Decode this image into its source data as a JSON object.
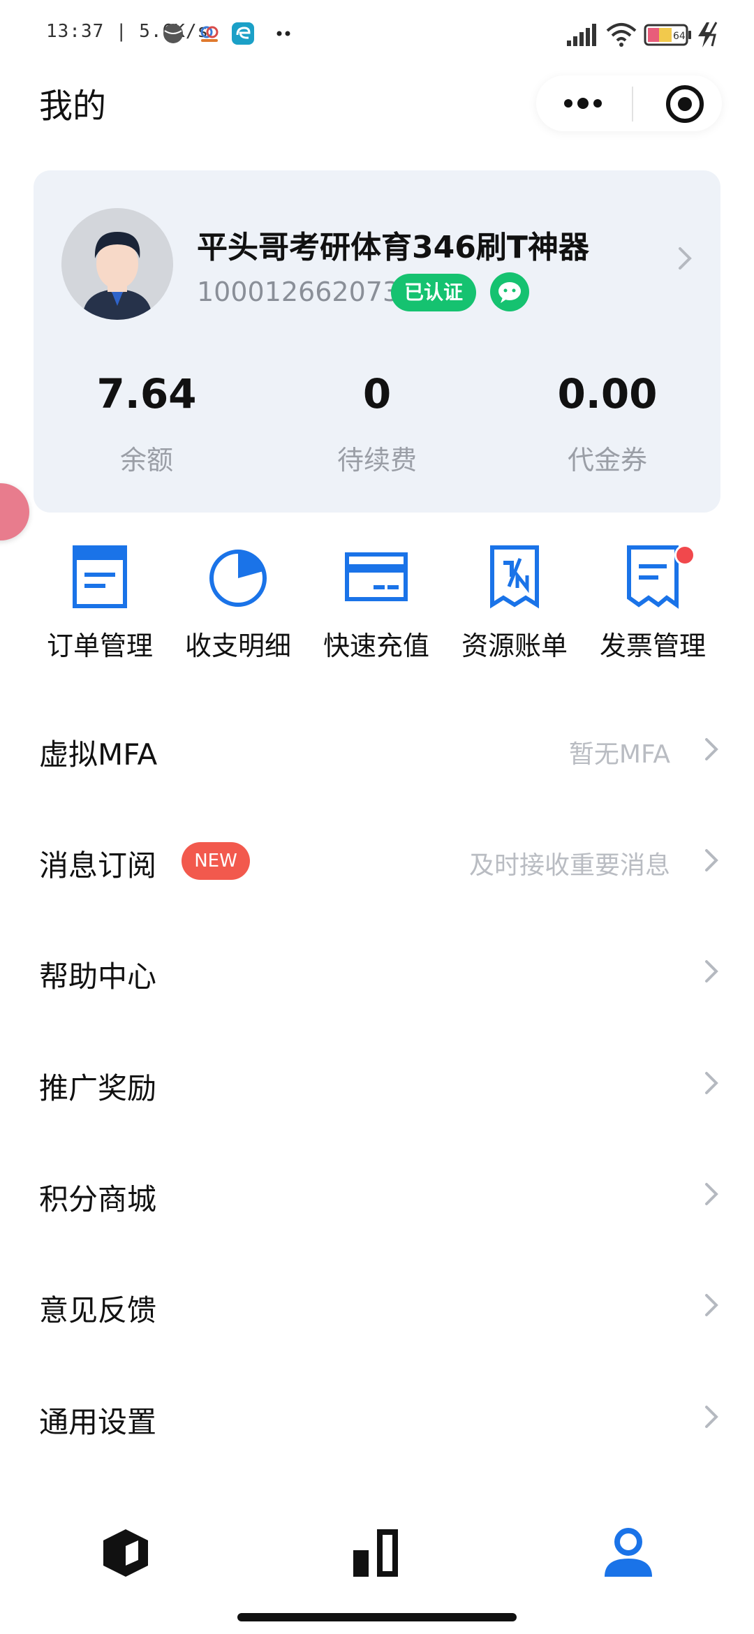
{
  "status_bar": {
    "time_speed": "13:37 | 5.6K/s",
    "icons": [
      "ball-icon",
      "cloud-icon",
      "edge-icon",
      "more-dots-icon"
    ],
    "right_icons": [
      "signal-icon",
      "wifi-icon",
      "battery-icon",
      "charging-icon"
    ],
    "battery_level": "64"
  },
  "header": {
    "title": "我的",
    "capsule": {
      "more_icon": "more-dots-icon",
      "close_icon": "target-icon"
    }
  },
  "profile": {
    "name": "平头哥考研体育346刷T神器",
    "user_id": "100012662073",
    "verified_label": "已认证",
    "wechat_icon": "wechat-icon",
    "stats": [
      {
        "value": "7.64",
        "label": "余额"
      },
      {
        "value": "0",
        "label": "待续费"
      },
      {
        "value": "0.00",
        "label": "代金券"
      }
    ]
  },
  "quick_actions": [
    {
      "label": "订单管理",
      "icon": "order-doc-icon"
    },
    {
      "label": "收支明细",
      "icon": "pie-chart-icon"
    },
    {
      "label": "快速充值",
      "icon": "card-icon"
    },
    {
      "label": "资源账单",
      "icon": "bill-receipt-icon"
    },
    {
      "label": "发票管理",
      "icon": "invoice-icon",
      "has_dot": true
    }
  ],
  "menu": [
    {
      "label": "虚拟MFA",
      "hint": "暂无MFA"
    },
    {
      "label": "消息订阅",
      "badge": "NEW",
      "hint": "及时接收重要消息"
    },
    {
      "label": "帮助中心",
      "hint": ""
    },
    {
      "label": "推广奖励",
      "hint": ""
    },
    {
      "label": "积分商城",
      "hint": ""
    },
    {
      "label": "意见反馈",
      "hint": ""
    },
    {
      "label": "通用设置",
      "hint": ""
    }
  ],
  "tab_bar": {
    "tabs": [
      "cube-icon",
      "bar-chart-icon",
      "user-icon"
    ],
    "active": "user-icon"
  },
  "colors": {
    "accent": "#1a73e8",
    "card_bg": "#eef2f8",
    "verified": "#15c270",
    "badge": "#f2594d"
  }
}
